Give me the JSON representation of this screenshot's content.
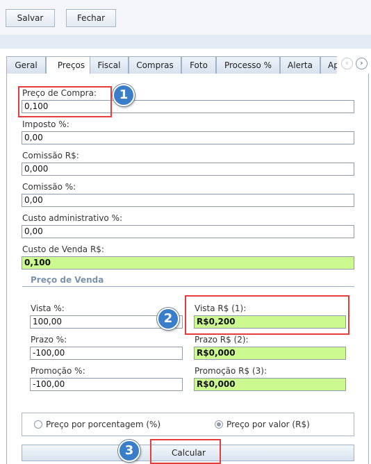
{
  "toolbar": {
    "save_label": "Salvar",
    "close_label": "Fechar"
  },
  "tabs": [
    "Geral",
    "Preços",
    "Fiscal",
    "Compras",
    "Foto",
    "Processo %",
    "Alerta",
    "Ap"
  ],
  "active_tab": "Preços",
  "tab_nav": {
    "prev_icon": "chevron-left-icon",
    "next_icon": "chevron-right-icon",
    "prev_glyph": "‹",
    "next_glyph": "›"
  },
  "costs": {
    "preco_compra": {
      "label": "Preço de Compra:",
      "value": "0,100"
    },
    "imposto": {
      "label": "Imposto %:",
      "value": "0,00"
    },
    "comissao_rs": {
      "label": "Comissão R$:",
      "value": "0,000"
    },
    "comissao_pct": {
      "label": "Comissão %:",
      "value": "0,00"
    },
    "custo_adm": {
      "label": "Custo administrativo %:",
      "value": "0,00"
    },
    "custo_venda": {
      "label": "Custo de Venda R$:",
      "value": "0,100"
    }
  },
  "preco_venda": {
    "title": "Preço de Venda",
    "vista_pct": {
      "label": "Vista %:",
      "value": "100,00"
    },
    "prazo_pct": {
      "label": "Prazo %:",
      "value": "-100,00"
    },
    "promocao_pct": {
      "label": "Promoção %:",
      "value": "-100,00"
    },
    "vista_rs": {
      "label": "Vista R$ (1):",
      "value": "R$0,200"
    },
    "prazo_rs": {
      "label": "Prazo R$ (2):",
      "value": "R$0,000"
    },
    "promocao_rs": {
      "label": "Promoção R$ (3):",
      "value": "R$0,000"
    }
  },
  "mode": {
    "options": [
      "Preço por porcentagem (%)",
      "Preço por valor (R$)"
    ],
    "selected": "Preço por valor (R$)"
  },
  "calc_label": "Calcular",
  "annotations": {
    "badge1": "1",
    "badge2": "2",
    "badge3": "3",
    "highlight_color": "#e63b3b",
    "badge_color": "#3a7dc8"
  },
  "colors": {
    "computed_field": "#ccf990",
    "section_title": "#7d93ad"
  }
}
